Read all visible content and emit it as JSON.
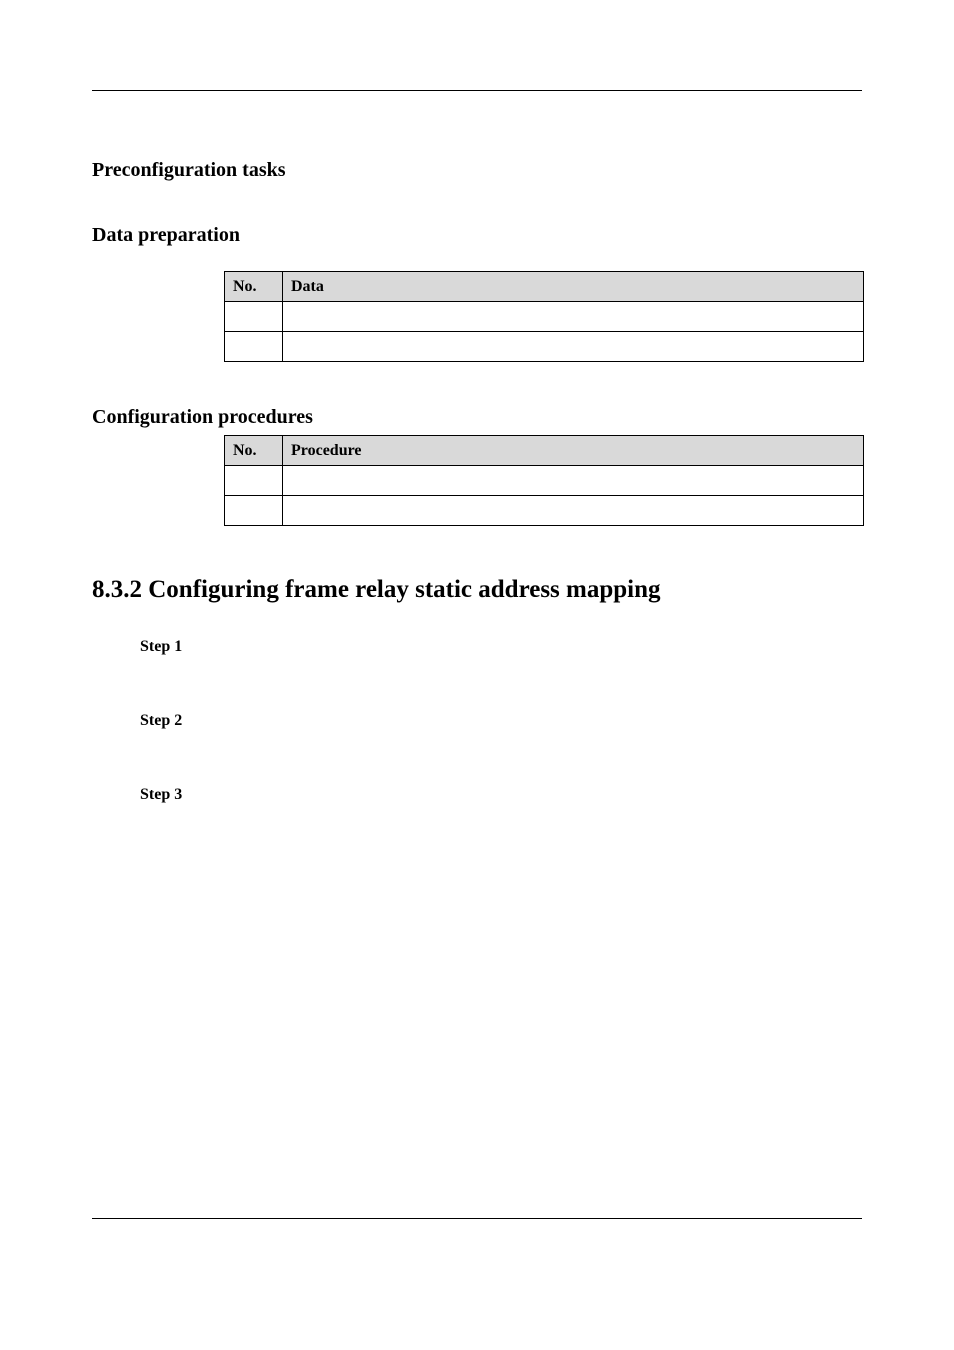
{
  "sections": {
    "preconfig_heading": "Preconfiguration tasks",
    "dataprep_heading": "Data preparation",
    "configproc_heading": "Configuration procedures",
    "main_heading": "8.3.2 Configuring frame relay static address mapping"
  },
  "data_table": {
    "header_no": "No.",
    "header_data": "Data",
    "rows": [
      {
        "no": "",
        "data": ""
      },
      {
        "no": "",
        "data": ""
      }
    ]
  },
  "proc_table": {
    "header_no": "No.",
    "header_proc": "Procedure",
    "rows": [
      {
        "no": "",
        "proc": ""
      },
      {
        "no": "",
        "proc": ""
      }
    ]
  },
  "steps": {
    "s1": "Step 1",
    "s2": "Step 2",
    "s3": "Step 3"
  }
}
